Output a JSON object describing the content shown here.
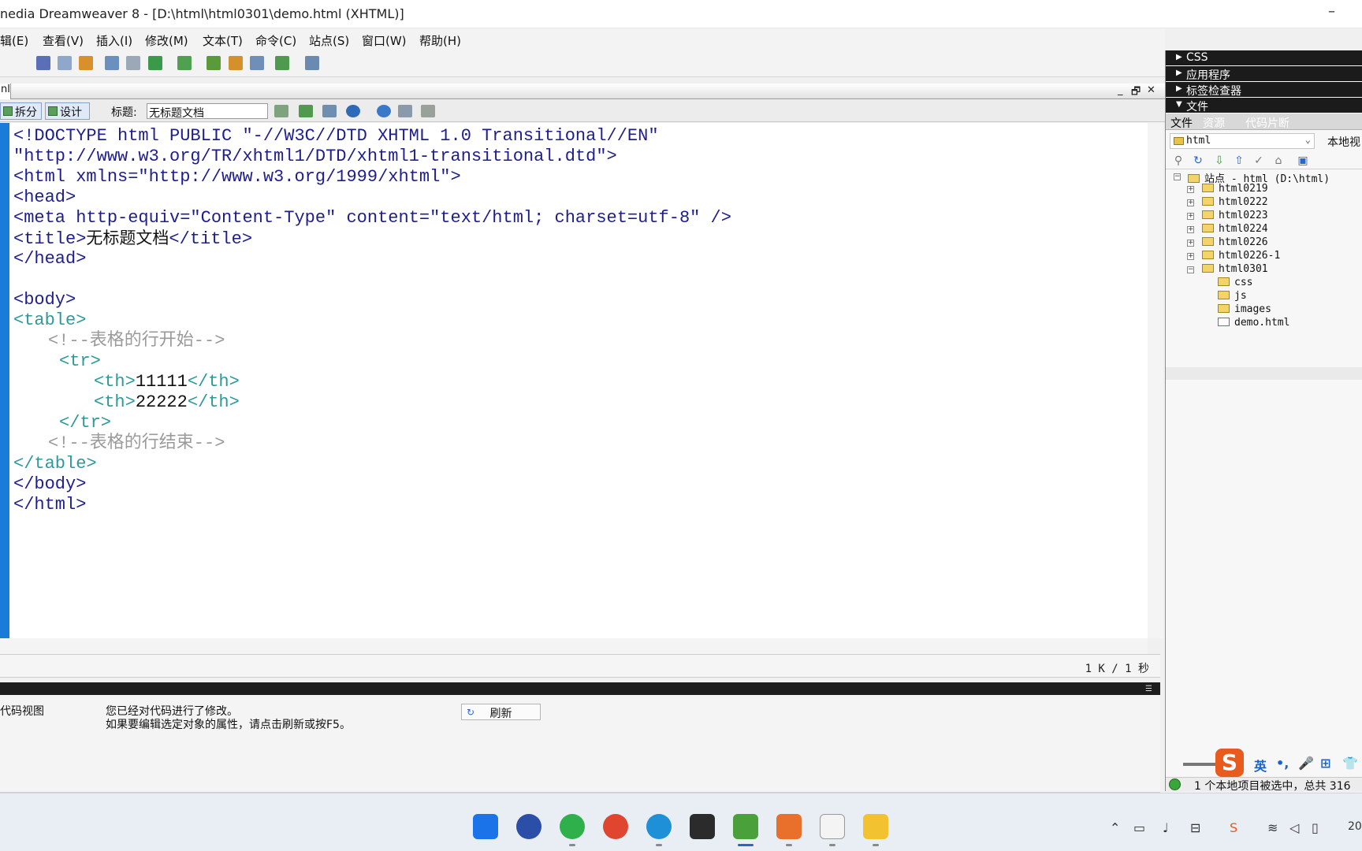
{
  "window": {
    "title": "nedia Dreamweaver 8 - [D:\\html\\html0301\\demo.html (XHTML)]",
    "minimize": "–"
  },
  "menu": [
    "辑(E)",
    "查看(V)",
    "插入(I)",
    "修改(M)",
    "文本(T)",
    "命令(C)",
    "站点(S)",
    "窗口(W)",
    "帮助(H)"
  ],
  "doc_tab": {
    "label": "nl",
    "minimize": "_",
    "restore": "🗗",
    "close": "✕"
  },
  "doc_toolbar": {
    "split_label": "拆分",
    "design_label": "设计",
    "title_label": "标题:",
    "title_value": "无标题文档"
  },
  "code_lines": [
    "<!DOCTYPE html PUBLIC \"-//W3C//DTD XHTML 1.0 Transitional//EN\"",
    "\"http://www.w3.org/TR/xhtml1/DTD/xhtml1-transitional.dtd\">",
    "<html xmlns=\"http://www.w3.org/1999/xhtml\">",
    "<head>",
    "<meta http-equiv=\"Content-Type\" content=\"text/html; charset=utf-8\" />",
    "<title>",
    "无标题文档",
    "</title>",
    "</head>",
    "<body>",
    "<table>",
    "<!--表格的行开始-->",
    "<tr>",
    "<th>",
    "11111",
    "</th>",
    "<th>",
    "22222",
    "</th>",
    "</tr>",
    "<!--表格的行结束-->",
    "</table>",
    "</body>",
    "</html>"
  ],
  "status": {
    "size": "1 K / 1 秒"
  },
  "properties": {
    "left_label": "代码视图",
    "message_line1": "您已经对代码进行了修改。",
    "message_line2": "如果要编辑选定对象的属性，请点击刷新或按F5。",
    "refresh_label": "刷新"
  },
  "panels": {
    "css": "CSS",
    "app": "应用程序",
    "tag_inspector": "标签检查器",
    "files": "文件",
    "files_tabs": [
      "文件",
      "资源",
      "代码片断"
    ],
    "site_value": "html",
    "view_value": "本地视",
    "tree": [
      {
        "label": "站点 - html (D:\\html)",
        "exp": "−"
      },
      {
        "label": "html0219",
        "exp": "+"
      },
      {
        "label": "html0222",
        "exp": "+"
      },
      {
        "label": "html0223",
        "exp": "+"
      },
      {
        "label": "html0224",
        "exp": "+"
      },
      {
        "label": "html0226",
        "exp": "+"
      },
      {
        "label": "html0226-1",
        "exp": "+"
      },
      {
        "label": "html0301",
        "exp": "−"
      },
      {
        "label": "css",
        "exp": ""
      },
      {
        "label": "js",
        "exp": ""
      },
      {
        "label": "images",
        "exp": ""
      },
      {
        "label": "demo.html",
        "exp": ""
      }
    ],
    "status": "1 个本地项目被选中，总共 316"
  },
  "ime": {
    "lang": "英",
    "punct": "•,",
    "mic": "🎤",
    "keyboard": "⊞",
    "skin": "👕"
  },
  "taskbar": {
    "clock": "20"
  }
}
